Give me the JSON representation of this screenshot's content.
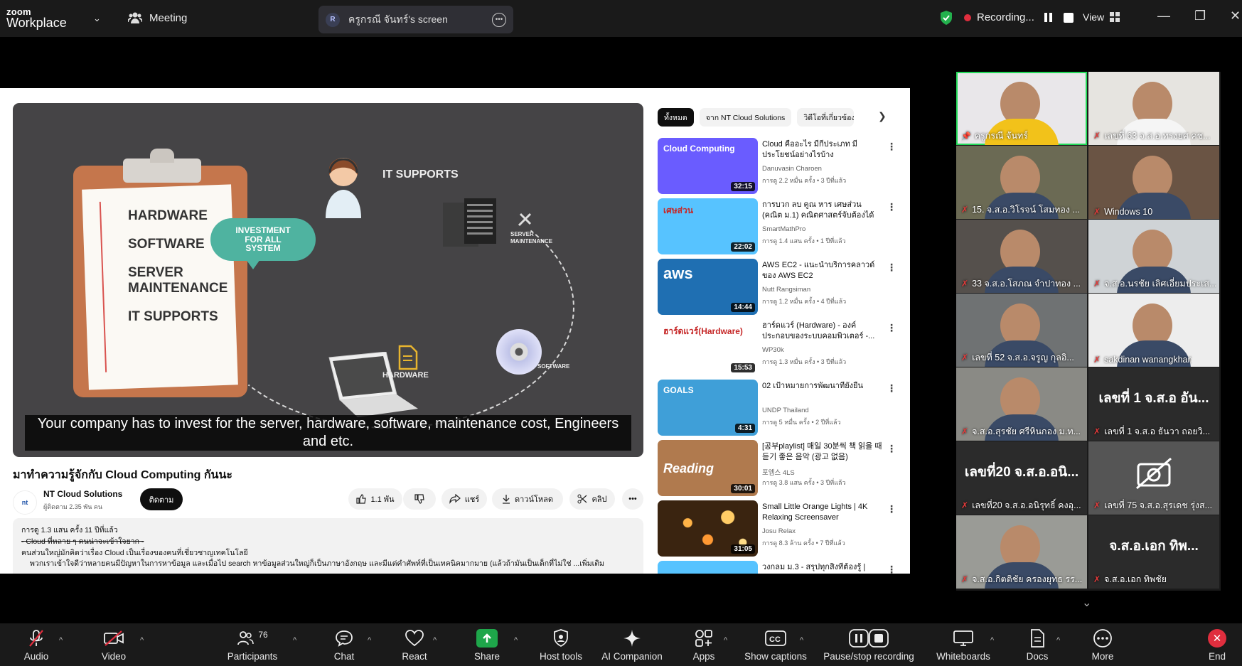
{
  "app": {
    "logo_line1": "zoom",
    "logo_line2": "Workplace",
    "meeting_label": "Meeting",
    "screen_share_avatar": "R",
    "screen_share_label": "ครูกรณี  จันทร์'s screen",
    "recording_label": "Recording...",
    "view_label": "View",
    "accent_green": "#23d959",
    "record_red": "#e02e3e"
  },
  "video": {
    "left_list": [
      "HARDWARE",
      "SOFTWARE",
      "SERVER MAINTENANCE",
      "IT SUPPORTS"
    ],
    "bubble_text": "INVESTMENT FOR ALL SYSTEM",
    "label_it_supports": "IT SUPPORTS",
    "label_server_maint": "SERVER MAINTENANCE",
    "label_hardware": "HARDWARE",
    "label_software": "SOFTWARE",
    "caption": "Your company has to invest for the server, hardware, software, maintenance cost, Engineers and etc.",
    "title": "มาทำความรู้จักกับ Cloud Computing กันนะ",
    "channel_logo": "nt",
    "channel_name": "NT Cloud Solutions",
    "channel_subs": "ผู้ติดตาม 2.35 พัน คน",
    "subscribe_label": "ติดตาม",
    "like_count": "1.1 พัน",
    "share_label": "แชร์",
    "download_label": "ดาวน์โหลด",
    "clip_label": "คลิป",
    "desc_line1": "การดู 1.3 แสน ครั้ง  11 ปีที่แล้ว",
    "desc_line2": "- Cloud ที่หลาย ๆ คนน่าจะเข้าใจยาก -",
    "desc_line3": "คนส่วนใหญ่มักคิดว่าเรื่อง Cloud เป็นเรื่องของคนที่เชี่ยวชาญเทคโนโลยี",
    "desc_line4": "พวกเราเข้าใจดีว่าหลายคนมีปัญหาในการหาข้อมูล และเมื่อไป search หาข้อมูลส่วนใหญ่ก็เป็นภาษาอังกฤษ และมีแต่คำศัพท์ที่เป็นเทคนิคมากมาย (แล้วถ้ามันเป็นเด็กที่ไม่ใช่ ...เพิ่มเติม"
  },
  "chips": [
    "ทั้งหมด",
    "จาก NT Cloud Solutions",
    "วิดีโอที่เกี่ยวข้อง"
  ],
  "recommendations": [
    {
      "title": "Cloud คืออะไร มีกี่ประเภท มีประโยชน์อย่างไรบ้าง",
      "channel": "Danuvasin Charoen",
      "meta": "การดู 2.2 หมื่น ครั้ง • 3 ปีที่แล้ว",
      "duration": "32:15",
      "thumb_text": "Cloud Computing",
      "color": "#6a5cff"
    },
    {
      "title": "การบวก ลบ คูณ หาร เศษส่วน (คณิต ม.1) คณิตศาสตร์จับต้องได้ ม.ต้น...",
      "channel": "SmartMathPro",
      "meta": "การดู 1.4 แสน ครั้ง • 1 ปีที่แล้ว",
      "duration": "22:02",
      "thumb_text": "เศษส่วน",
      "color": "#57c3ff"
    },
    {
      "title": "AWS EC2 - แนะนำบริการคลาวด์ ของ AWS EC2",
      "channel": "Nutt Rangsiman",
      "meta": "การดู 1.2 หมื่น ครั้ง • 4 ปีที่แล้ว",
      "duration": "14:44",
      "thumb_text": "aws",
      "color": "#1f6fb2"
    },
    {
      "title": "ฮาร์ดแวร์ (Hardware) - องค์ประกอบของระบบคอมพิวเตอร์ -...",
      "channel": "WP30k",
      "meta": "การดู 1.3 หมื่น ครั้ง • 3 ปีที่แล้ว",
      "duration": "15:53",
      "thumb_text": "ฮาร์ดแวร์(Hardware)",
      "color": "#ffffff"
    },
    {
      "title": "02 เป้าหมายการพัฒนาที่ยั่งยืน",
      "channel": "UNDP Thailand",
      "meta": "การดู 5 หมื่น ครั้ง • 2 ปีที่แล้ว",
      "duration": "4:31",
      "thumb_text": "GOALS",
      "color": "#3f9fd8"
    },
    {
      "title": "[공부playlist] 매일 30분씩 책 읽을 때 듣기 좋은 음악 (광고 없음)",
      "channel": "포엠스 4LS",
      "meta": "การดู 3.8 แสน ครั้ง • 3 ปีที่แล้ว",
      "duration": "30:01",
      "thumb_text": "Reading",
      "color": "#b07a4e"
    },
    {
      "title": "Small Little Orange Lights | 4K Relaxing Screensaver",
      "channel": "Josu Relax",
      "meta": "การดู 8.3 ล้าน ครั้ง • 7 ปีที่แล้ว",
      "duration": "31:05",
      "thumb_text": "",
      "color": "#5a3a1c"
    },
    {
      "title": "วงกลม ม.3 - สรุปทุกสิ่งที่ต้องรู้ |",
      "channel": "",
      "meta": "",
      "duration": "",
      "thumb_text": "",
      "color": "#57c3ff"
    }
  ],
  "participants": [
    {
      "name": "ครูกรณี  จันทร์",
      "bg": "#e9e7ea",
      "active": true,
      "pinned": true
    },
    {
      "name": "เลขที่ 63 จ.ส.อ.ทรงยศ คช...",
      "bg": "#e6e4e0"
    },
    {
      "name": "15. จ.ส.อ.วิโรจน์  โสมทอง ...",
      "bg": "#6b6a54"
    },
    {
      "name": "Windows 10",
      "bg": "#6a5444"
    },
    {
      "name": "33 จ.ส.อ.โสภณ จำปาทอง ...",
      "bg": "#55504c"
    },
    {
      "name": "จ.ส.อ.นรชัย เลิศเอี่ยมประเส...",
      "bg": "#cfd3d6"
    },
    {
      "name": "เลขที่ 52 จ.ส.อ.จรูญ  กุลอิ...",
      "bg": "#6f7273"
    },
    {
      "name": "sakdinan wanangkhan",
      "bg": "#ededed"
    },
    {
      "name": "จ.ส.อ.สุรชัย ศรีหินกอง ม.ท...",
      "bg": "#8a8a85"
    },
    {
      "name": "เลขที่ 1 จ.ส.อ ธันวา ถอยวิ...",
      "bg": "#2b2b2b",
      "big": "เลขที่ 1 จ.ส.อ อัน..."
    },
    {
      "name": "เลขที่20 จ.ส.อ.อนิรุทธิ์ คงอุ...",
      "bg": "#2b2b2b",
      "big": "เลขที่20 จ.ส.อ.อนิ..."
    },
    {
      "name": "เลขที่ 75 จ.ส.อ.สุรเดช รุ่งส...",
      "bg": "#555",
      "camoff": true
    },
    {
      "name": "จ.ส.อ.กิตติชัย ครองยุทธ รร...",
      "bg": "#9a9b96"
    },
    {
      "name": "จ.ส.อ.เอก         ทิพชัย",
      "bg": "#2b2b2b",
      "big": "จ.ส.อ.เอก      ทิพ..."
    }
  ],
  "toolbar": {
    "audio": "Audio",
    "video": "Video",
    "participants": "Participants",
    "participants_count": "76",
    "chat": "Chat",
    "react": "React",
    "share": "Share",
    "host_tools": "Host tools",
    "ai_companion": "AI Companion",
    "apps": "Apps",
    "show_captions": "Show captions",
    "pause_stop_recording": "Pause/stop recording",
    "whiteboards": "Whiteboards",
    "docs": "Docs",
    "more": "More",
    "end": "End"
  }
}
